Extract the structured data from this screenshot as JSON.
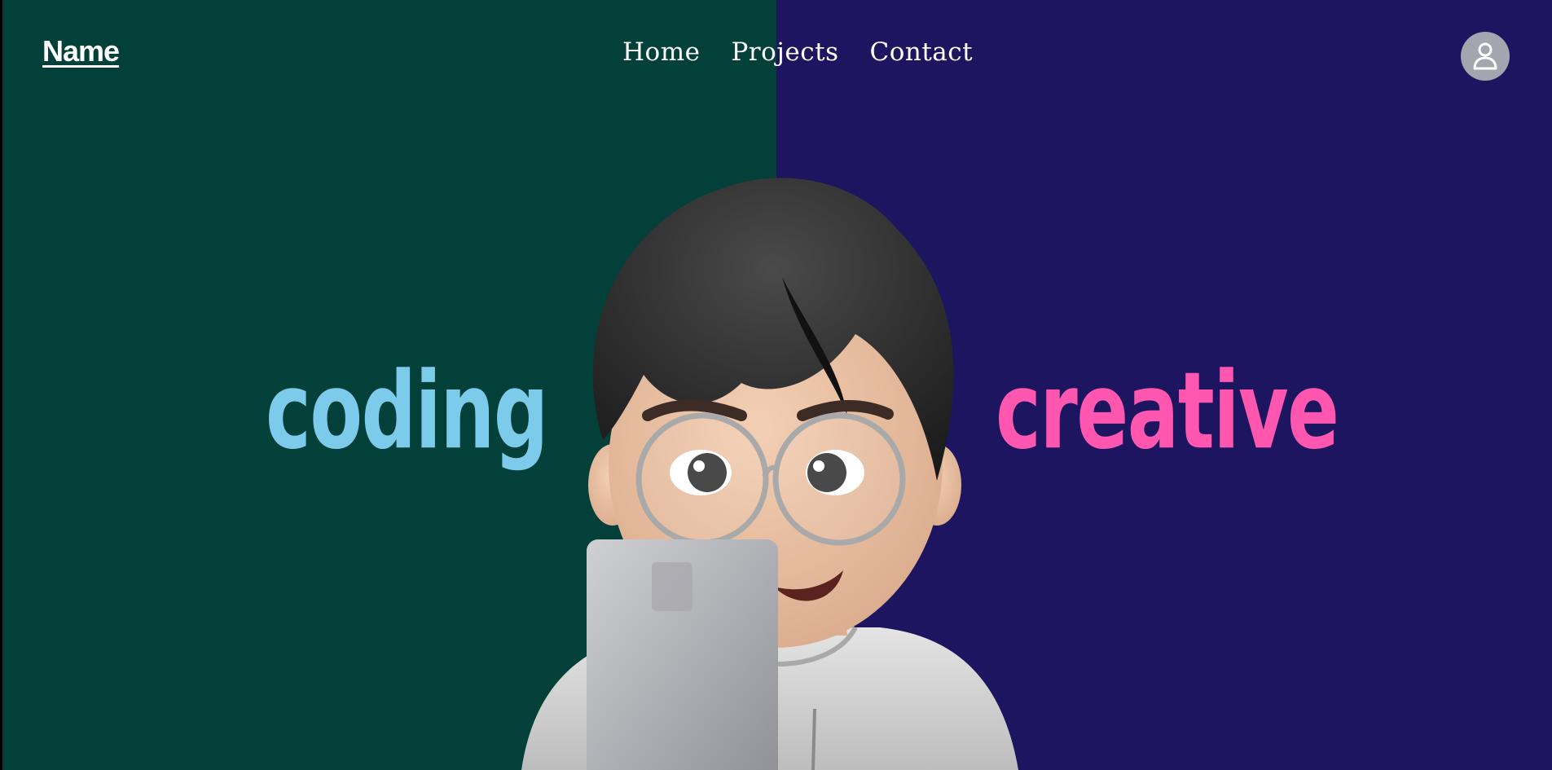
{
  "header": {
    "brand": "Name",
    "nav": [
      {
        "label": "Home"
      },
      {
        "label": "Projects"
      },
      {
        "label": "Contact"
      }
    ],
    "profile_icon": "user-icon"
  },
  "hero": {
    "left_word": "coding",
    "right_word": "creative",
    "avatar_icon": "memoji-avatar"
  },
  "colors": {
    "left_background": "#024039",
    "right_background": "#1d1560",
    "left_word": "#7dcbea",
    "right_word": "#ff57b0",
    "profile_button": "#a3a6ae"
  }
}
